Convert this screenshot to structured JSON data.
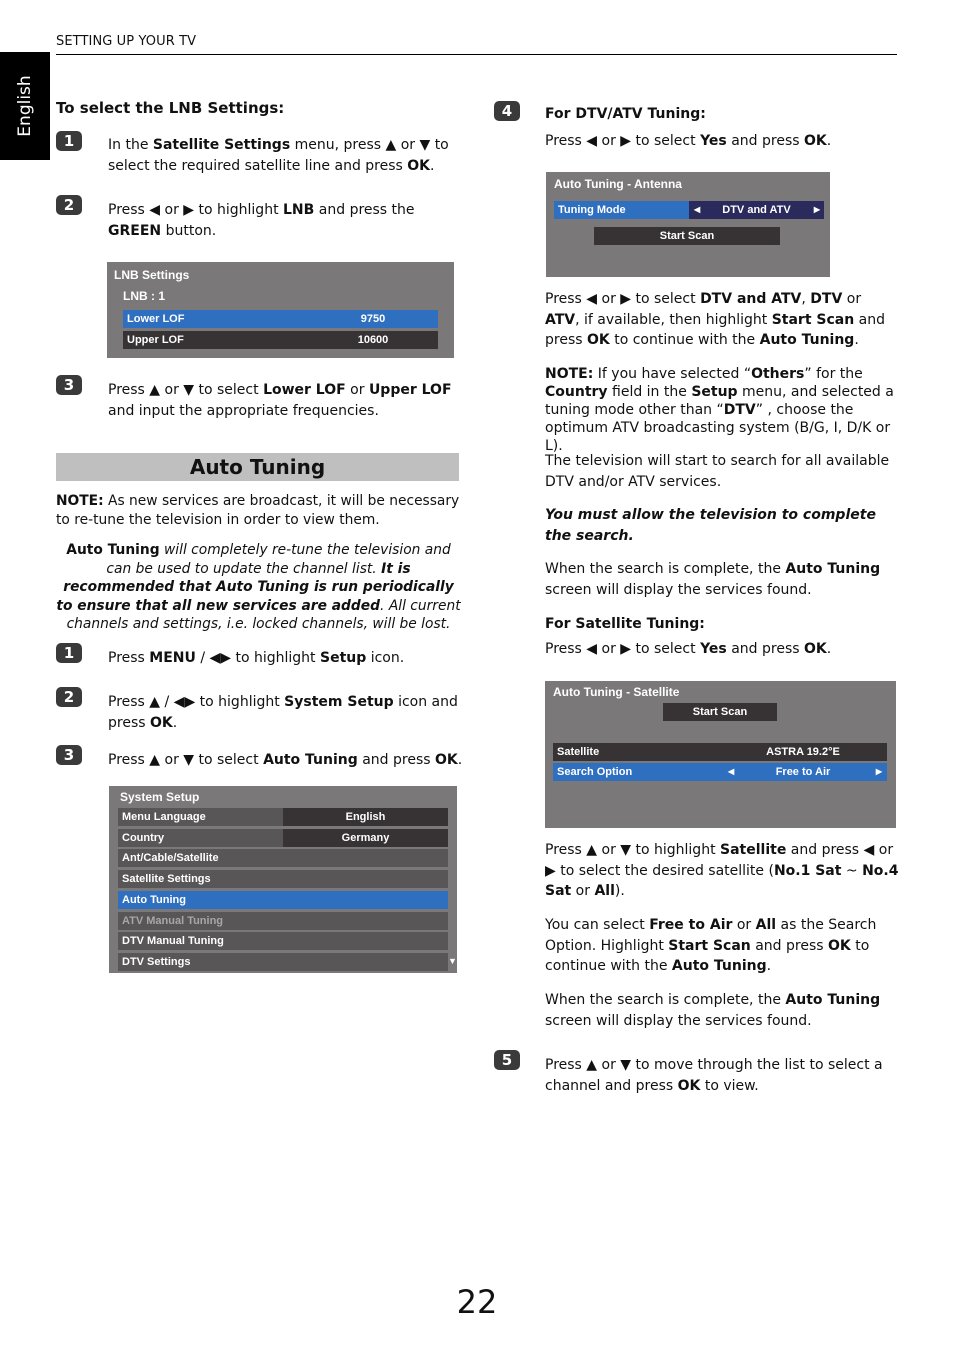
{
  "header": {
    "section": "SETTING UP YOUR TV",
    "language_tab": "English"
  },
  "page_number": "22",
  "lnb": {
    "heading": "To select the LNB Settings:",
    "steps": [
      {
        "num": "1",
        "html": "In the <b>Satellite Settings</b> menu, press ▲ or ▼ to select the required satellite line and press <b>OK</b>."
      },
      {
        "num": "2",
        "html": "Press ◀ or ▶ to highlight <b>LNB</b> and press the <b>GREEN</b> button."
      },
      {
        "num": "3",
        "html": "Press ▲ or ▼ to select <b>Lower LOF</b> or <b>Upper LOF</b> and input the appropriate frequencies."
      }
    ],
    "menu": {
      "title": "LNB Settings",
      "subtitle": "LNB : 1",
      "rows": [
        {
          "label": "Lower LOF",
          "value": "9750",
          "state": "highlighted"
        },
        {
          "label": "Upper LOF",
          "value": "10600",
          "state": "normal"
        }
      ]
    }
  },
  "auto_tuning": {
    "title": "Auto Tuning",
    "note_html": "<b>NOTE:</b> As new services are broadcast, it will be necessary to re-tune the television in order to view them.",
    "warning_html": "<b>Auto Tuning</b> <i>will completely re-tune the television and can be used to update the channel list.</i> <b><i>It is recommended that Auto Tuning is run periodically to ensure that all new services are added</i></b><i>. All current channels and settings, i.e. locked channels, will be lost.</i>",
    "steps": [
      {
        "num": "1",
        "html": "Press <b>MENU</b> / ◀▶ to highlight <b>Setup</b> icon."
      },
      {
        "num": "2",
        "html": "Press ▲ / ◀▶ to highlight <b>System Setup</b> icon and press <b>OK</b>."
      },
      {
        "num": "3",
        "html": "Press ▲ or ▼ to select <b>Auto Tuning</b> and press <b>OK</b>."
      },
      {
        "num": "4",
        "html": ""
      },
      {
        "num": "5",
        "html": "Press ▲ or ▼ to move through the list to select a channel and press <b>OK</b> to view."
      }
    ],
    "system_setup_menu": {
      "title": "System Setup",
      "rows": [
        {
          "label": "Menu Language",
          "value": "English",
          "state": "normal"
        },
        {
          "label": "Country",
          "value": "Germany",
          "state": "normal"
        },
        {
          "label": "Ant/Cable/Satellite",
          "value": "",
          "state": "normal"
        },
        {
          "label": "Satellite Settings",
          "value": "",
          "state": "normal"
        },
        {
          "label": "Auto Tuning",
          "value": "",
          "state": "highlighted"
        },
        {
          "label": "ATV Manual Tuning",
          "value": "",
          "state": "disabled"
        },
        {
          "label": "DTV Manual Tuning",
          "value": "",
          "state": "normal"
        },
        {
          "label": "DTV Settings",
          "value": "",
          "state": "normal"
        }
      ],
      "scroll_indicator": "▼"
    },
    "dtv_atv": {
      "heading": "For DTV/ATV Tuning:",
      "instruction_html": "Press ◀ or ▶ to select <b>Yes</b> and press <b>OK</b>.",
      "menu": {
        "title": "Auto Tuning - Antenna",
        "tuning_mode_label": "Tuning Mode",
        "tuning_mode_value": "DTV and ATV",
        "start_scan": "Start Scan"
      },
      "p1_html": "Press ◀ or ▶ to select <b>DTV and ATV</b>, <b>DTV</b> or <b>ATV</b>, if available, then highlight <b>Start Scan</b> and press <b>OK</b> to continue with the <b>Auto Tuning</b>.",
      "note_html": "<b>NOTE:</b> If you have selected “<b>Others</b>” for the <b>Country</b> field in the <b>Setup</b> menu, and selected a tuning mode other than “<b>DTV</b>” , choose the optimum ATV broadcasting system (B/G, I, D/K or L).",
      "p2": "The television will start to search for all available DTV and/or ATV services.",
      "warning": "You must allow the television to complete the search.",
      "p3_html": "When the search is complete, the <b>Auto Tuning</b> screen will display the services found."
    },
    "satellite": {
      "heading": "For Satellite Tuning:",
      "instruction_html": "Press ◀ or ▶ to select <b>Yes</b> and press <b>OK</b>.",
      "menu": {
        "title": "Auto Tuning - Satellite",
        "start_scan": "Start Scan",
        "satellite_label": "Satellite",
        "satellite_value": "ASTRA 19.2°E",
        "search_option_label": "Search Option",
        "search_option_value": "Free to Air"
      },
      "p1_html": "Press ▲ or ▼ to highlight <b>Satellite</b> and press ◀ or ▶ to select the desired satellite (<b>No.1 Sat</b> ~ <b>No.4 Sat</b> or <b>All</b>).",
      "p2_html": "You can select <b>Free to Air</b> or <b>All</b> as the Search Option. Highlight <b>Start Scan</b> and press <b>OK</b> to continue with the <b>Auto Tuning</b>.",
      "p3_html": "When the search is complete, the <b>Auto Tuning</b> screen will display the services found."
    }
  },
  "colors": {
    "highlight_blue": "#2e6fc0",
    "menu_bg": "#7a7878",
    "row_dark": "#373334",
    "section_bar": "#bfbfbf"
  }
}
